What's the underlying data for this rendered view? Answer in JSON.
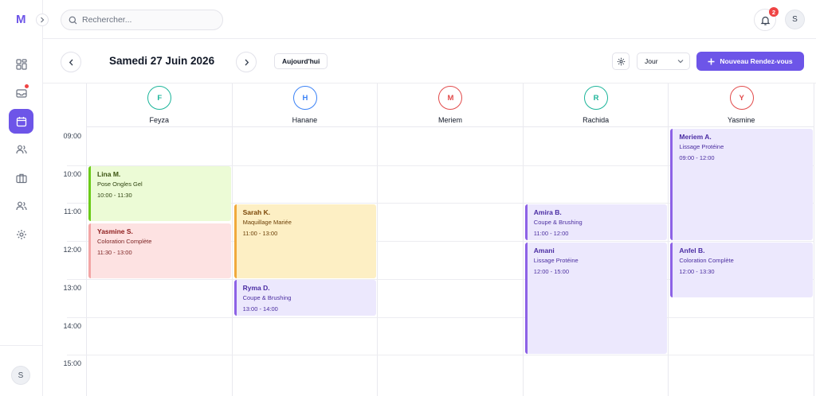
{
  "app": {
    "logo": "M"
  },
  "search": {
    "placeholder": "Rechercher..."
  },
  "notifications": {
    "count": "2"
  },
  "user": {
    "initial": "S"
  },
  "toolbar": {
    "date_title": "Samedi 27 Juin 2026",
    "today_label": "Aujourd'hui",
    "view_value": "Jour",
    "new_label": "Nouveau Rendez-vous"
  },
  "sidebar": {
    "items": [
      {
        "name": "dashboard-icon"
      },
      {
        "name": "inbox-icon",
        "has_dot": true
      },
      {
        "name": "calendar-icon",
        "active": true
      },
      {
        "name": "users-icon"
      },
      {
        "name": "briefcase-icon"
      },
      {
        "name": "team-icon"
      },
      {
        "name": "gear-icon"
      }
    ],
    "avatar_initial": "S"
  },
  "hours": [
    "09:00",
    "10:00",
    "11:00",
    "12:00",
    "13:00",
    "14:00",
    "15:00"
  ],
  "staff": [
    {
      "initial": "F",
      "name": "Feyza",
      "color": "#1cb59a"
    },
    {
      "initial": "H",
      "name": "Hanane",
      "color": "#3b82f6"
    },
    {
      "initial": "M",
      "name": "Meriem",
      "color": "#e24b4b"
    },
    {
      "initial": "R",
      "name": "Rachida",
      "color": "#1cb59a"
    },
    {
      "initial": "Y",
      "name": "Yasmine",
      "color": "#e24b4b"
    }
  ],
  "appointments": [
    {
      "staff": 0,
      "client": "Lina M.",
      "service": "Pose Ongles Gel",
      "time": "10:00 - 11:30",
      "start_hour": 10.0,
      "end_hour": 11.5,
      "color": "green"
    },
    {
      "staff": 0,
      "client": "Yasmine S.",
      "service": "Coloration Complète",
      "time": "11:30 - 13:00",
      "start_hour": 11.5,
      "end_hour": 13.0,
      "color": "red"
    },
    {
      "staff": 1,
      "client": "Sarah K.",
      "service": "Maquillage Mariée",
      "time": "11:00 - 13:00",
      "start_hour": 11.0,
      "end_hour": 13.0,
      "color": "yellow"
    },
    {
      "staff": 1,
      "client": "Ryma D.",
      "service": "Coupe & Brushing",
      "time": "13:00 - 14:00",
      "start_hour": 13.0,
      "end_hour": 14.0,
      "color": "purple"
    },
    {
      "staff": 3,
      "client": "Amira B.",
      "service": "Coupe & Brushing",
      "time": "11:00 - 12:00",
      "start_hour": 11.0,
      "end_hour": 12.0,
      "color": "purple"
    },
    {
      "staff": 3,
      "client": "Amani",
      "service": "Lissage Protéine",
      "time": "12:00 - 15:00",
      "start_hour": 12.0,
      "end_hour": 15.0,
      "color": "purple"
    },
    {
      "staff": 4,
      "client": "Meriem A.",
      "service": "Lissage Protéine",
      "time": "09:00 - 12:00",
      "start_hour": 9.0,
      "end_hour": 12.0,
      "color": "purple"
    },
    {
      "staff": 4,
      "client": "Anfel B.",
      "service": "Coloration Complète",
      "time": "12:00 - 13:30",
      "start_hour": 12.0,
      "end_hour": 13.5,
      "color": "purple"
    }
  ]
}
